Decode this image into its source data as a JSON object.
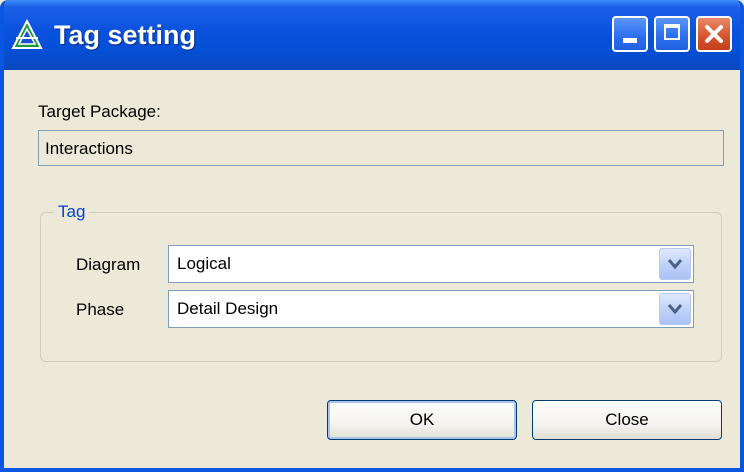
{
  "window": {
    "title": "Tag setting",
    "icon": "app-logo-icon",
    "controls": [
      "minimize-icon",
      "maximize-icon",
      "close-icon"
    ]
  },
  "target_package": {
    "label": "Target Package:",
    "value": "Interactions"
  },
  "tag_group": {
    "legend": "Tag",
    "diagram": {
      "label": "Diagram",
      "value": "Logical"
    },
    "phase": {
      "label": "Phase",
      "value": "Detail Design"
    }
  },
  "buttons": {
    "ok": "OK",
    "close": "Close"
  },
  "colors": {
    "titlebar": "#0a52dd",
    "group_legend": "#0046d5",
    "close_button": "#d5522a"
  }
}
